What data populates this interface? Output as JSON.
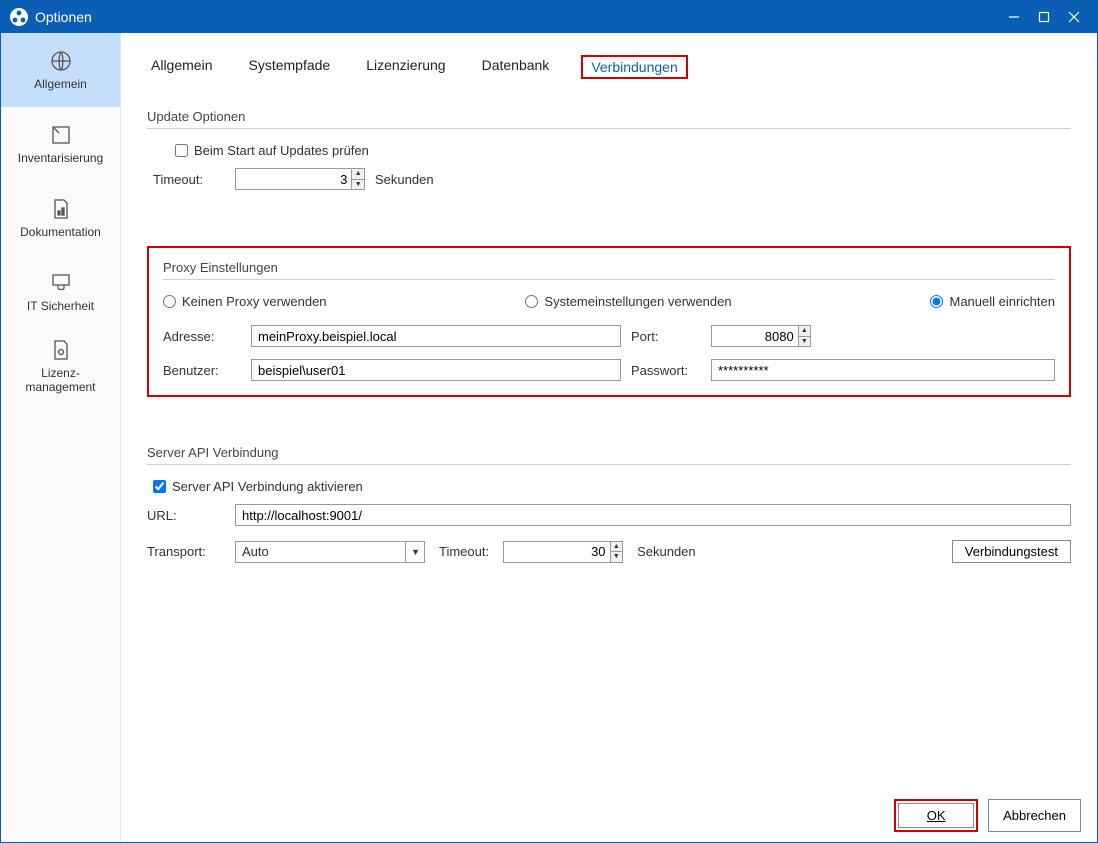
{
  "window": {
    "title": "Optionen"
  },
  "sidebar": {
    "items": [
      {
        "label": "Allgemein"
      },
      {
        "label": "Inventarisierung"
      },
      {
        "label": "Dokumentation"
      },
      {
        "label": "IT Sicherheit"
      },
      {
        "label": "Lizenz-\nmanagement"
      }
    ]
  },
  "tabs": {
    "items": [
      {
        "label": "Allgemein"
      },
      {
        "label": "Systempfade"
      },
      {
        "label": "Lizenzierung"
      },
      {
        "label": "Datenbank"
      },
      {
        "label": "Verbindungen"
      }
    ]
  },
  "update": {
    "section": "Update Optionen",
    "check_label": "Beim Start auf Updates prüfen",
    "check_value": false,
    "timeout_label": "Timeout:",
    "timeout_value": "3",
    "seconds_label": "Sekunden"
  },
  "proxy": {
    "section": "Proxy Einstellungen",
    "opt_none": "Keinen Proxy verwenden",
    "opt_system": "Systemeinstellungen verwenden",
    "opt_manual": "Manuell einrichten",
    "selected": "manual",
    "address_label": "Adresse:",
    "address_value": "meinProxy.beispiel.local",
    "port_label": "Port:",
    "port_value": "8080",
    "user_label": "Benutzer:",
    "user_value": "beispiel\\user01",
    "pass_label": "Passwort:",
    "pass_value": "**********"
  },
  "api": {
    "section": "Server API Verbindung",
    "enable_label": "Server API Verbindung aktivieren",
    "enable_value": true,
    "url_label": "URL:",
    "url_value": "http://localhost:9001/",
    "transport_label": "Transport:",
    "transport_value": "Auto",
    "timeout_label": "Timeout:",
    "timeout_value": "30",
    "seconds_label": "Sekunden",
    "test_label": "Verbindungstest"
  },
  "footer": {
    "ok": "OK",
    "cancel": "Abbrechen"
  }
}
